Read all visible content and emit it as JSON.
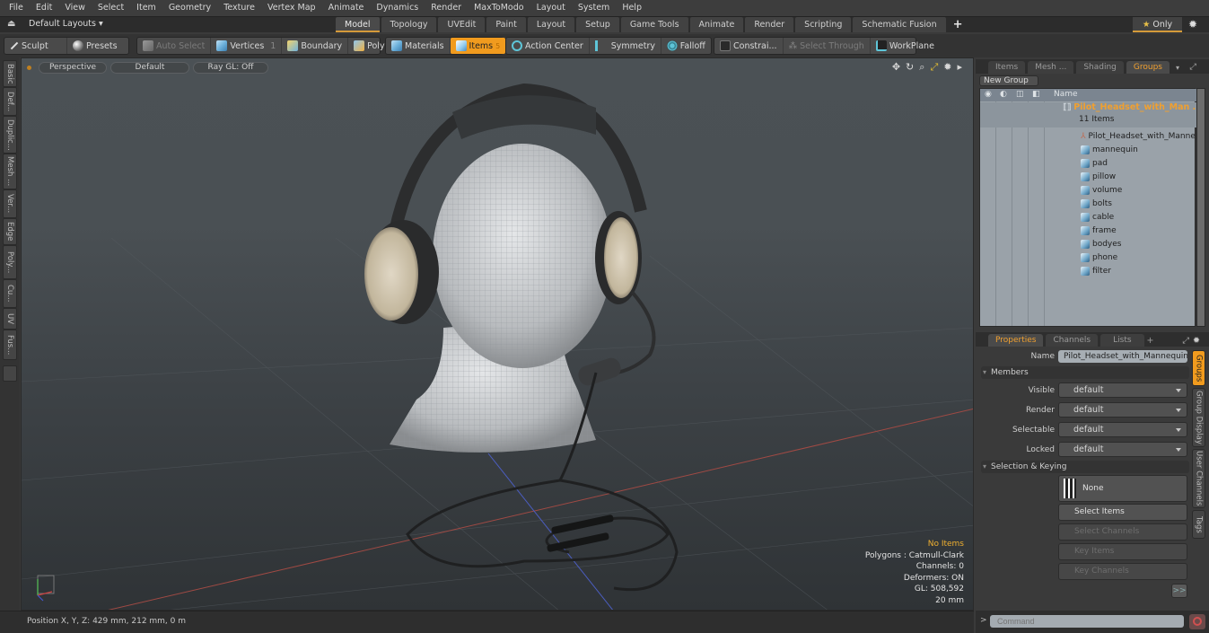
{
  "menu": [
    "File",
    "Edit",
    "View",
    "Select",
    "Item",
    "Geometry",
    "Texture",
    "Vertex Map",
    "Animate",
    "Dynamics",
    "Render",
    "MaxToModo",
    "Layout",
    "System",
    "Help"
  ],
  "layoutbar": {
    "layouts_dropdown": "Default Layouts ▾",
    "tabs": [
      "Model",
      "Topology",
      "UVEdit",
      "Paint",
      "Layout",
      "Setup",
      "Game Tools",
      "Animate",
      "Render",
      "Scripting",
      "Schematic Fusion"
    ],
    "active_tab": "Model",
    "add_tab": "+",
    "only_label": "Only",
    "star": "★"
  },
  "toolbar": {
    "sculpt": "Sculpt",
    "presets": "Presets",
    "auto_select": "Auto Select",
    "vertices": "Vertices",
    "vertices_count": "1",
    "boundary": "Boundary",
    "polygons": "Polygons",
    "materials": "Materials",
    "items": "Items",
    "items_count": "5",
    "action_center": "Action Center",
    "symmetry": "Symmetry",
    "falloff": "Falloff",
    "constraints": "Constrai...",
    "select_through": "Select Through",
    "workplane": "WorkPlane"
  },
  "left_tabs": [
    "Basic",
    "Def...",
    "Duplic...",
    "Mesh ...",
    "Ver...",
    "Edge",
    "Poly...",
    "Cu...",
    "UV",
    "Fus..."
  ],
  "viewport": {
    "view_mode": "Perspective",
    "shading": "Default",
    "raygl": "Ray GL: Off",
    "stats": {
      "items": "No Items",
      "polygons": "Polygons : Catmull-Clark",
      "channels": "Channels: 0",
      "deformers": "Deformers: ON",
      "gl": "GL: 508,592",
      "scale": "20 mm"
    }
  },
  "groups_panel": {
    "tabs": [
      "Items",
      "Mesh ...",
      "Shading",
      "Groups"
    ],
    "active_tab": "Groups",
    "new_group": "New Group",
    "column_name": "Name",
    "group": {
      "name": "Pilot_Headset_with_Man ...",
      "count": "11 Items"
    },
    "children": [
      "Pilot_Headset_with_Manne ...",
      "mannequin",
      "pad",
      "pillow",
      "volume",
      "bolts",
      "cable",
      "frame",
      "bodyes",
      "phone",
      "filter"
    ]
  },
  "properties_panel": {
    "tabs": [
      "Properties",
      "Channels",
      "Lists"
    ],
    "active_tab": "Properties",
    "add_tab": "+",
    "name_label": "Name",
    "name_value": "Pilot_Headset_with_Mannequin_H",
    "members_section": "Members",
    "members": [
      {
        "label": "Visible",
        "value": "default"
      },
      {
        "label": "Render",
        "value": "default"
      },
      {
        "label": "Selectable",
        "value": "default"
      },
      {
        "label": "Locked",
        "value": "default"
      }
    ],
    "selection_section": "Selection & Keying",
    "none_button": "None",
    "select_items": "Select Items",
    "select_channels": "Select Channels",
    "key_items": "Key Items",
    "key_channels": "Key Channels",
    "more": ">>",
    "side_tabs": [
      "Groups",
      "Group Display",
      "User Channels",
      "Tags"
    ]
  },
  "statusbar": {
    "position": "Position X, Y, Z:   429 mm, 212 mm, 0 m"
  },
  "command": {
    "prompt": ">",
    "placeholder": "Command"
  },
  "colors": {
    "accent": "#f19b1e",
    "group_name": "#f0a030",
    "list_bg": "#9aa2a9"
  }
}
